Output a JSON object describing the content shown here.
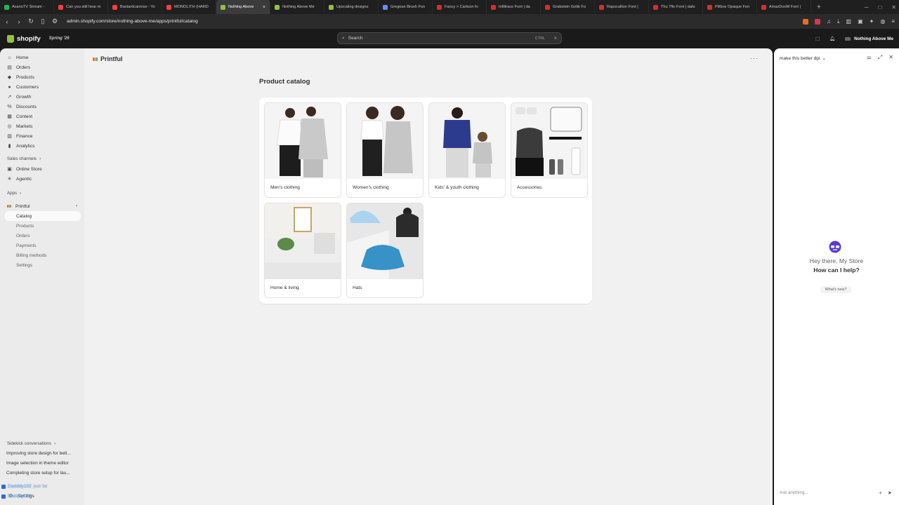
{
  "browser": {
    "tabs": [
      {
        "label": "AsanoTV Stream - ",
        "color": "#1db954"
      },
      {
        "label": "Can you still hear m",
        "color": "#ff3d3d"
      },
      {
        "label": "Bastardcannise - Yo",
        "color": "#ff3d3d"
      },
      {
        "label": "MONOLITH (HARD",
        "color": "#ff3d3d"
      },
      {
        "label": "Nothing Above",
        "color": "#95bf47"
      },
      {
        "label": "Nothing Above Me",
        "color": "#95bf47"
      },
      {
        "label": "Upscaling designs",
        "color": "#95bf47"
      },
      {
        "label": "Gregean Brush Fon",
        "color": "#6b8cff"
      },
      {
        "label": "Fancy > Cartoon fo",
        "color": "#d32f2f"
      },
      {
        "label": "Infiltrace Font | da",
        "color": "#d32f2f"
      },
      {
        "label": "Grabstein Gotik Fo",
        "color": "#d32f2f"
      },
      {
        "label": "Rapscallion Font | ",
        "color": "#d32f2f"
      },
      {
        "label": "Thu Tflo Font | dafu",
        "color": "#d32f2f"
      },
      {
        "label": "Pillbox Opaque Fon",
        "color": "#d32f2f"
      },
      {
        "label": "AmazDooM Font | ",
        "color": "#d32f2f"
      }
    ],
    "active_tab_index": 4,
    "url": "admin.shopify.com/store/nothing-above-me/apps/printful/catalog"
  },
  "topbar": {
    "logo_text": "shopify",
    "season": "Spring '26",
    "search_placeholder": "Search",
    "shortcut_key": "CTRL",
    "shortcut_letter": "K",
    "store_name": "Nothing Above Me"
  },
  "sidebar": {
    "main_nav": [
      {
        "label": "Home",
        "icon": "home-icon"
      },
      {
        "label": "Orders",
        "icon": "inbox-icon"
      },
      {
        "label": "Products",
        "icon": "tag-icon"
      },
      {
        "label": "Customers",
        "icon": "person-icon"
      },
      {
        "label": "Growth",
        "icon": "growth-icon"
      },
      {
        "label": "Discounts",
        "icon": "discount-icon"
      },
      {
        "label": "Content",
        "icon": "content-icon"
      },
      {
        "label": "Markets",
        "icon": "globe-icon"
      },
      {
        "label": "Finance",
        "icon": "bank-icon"
      },
      {
        "label": "Analytics",
        "icon": "chart-icon"
      }
    ],
    "sales_channels_heading": "Sales channels",
    "sales_channels": [
      {
        "label": "Online Store",
        "icon": "store-icon"
      },
      {
        "label": "Agentic",
        "icon": "agentic-icon"
      }
    ],
    "apps_heading": "Apps",
    "app_name": "Printful",
    "app_subitems": [
      "Catalog",
      "Products",
      "Orders",
      "Payments",
      "Billing methods",
      "Settings"
    ],
    "conversations_heading": "Sidekick conversations",
    "conversations": [
      "Improving store design for bett...",
      "Image selection in theme editor",
      "Completing store setup for lau..."
    ],
    "settings_label": "Settings",
    "chat_overlay": [
      {
        "user": "Dadddy102",
        "message": "just fat"
      },
      {
        "user": "Dadddy102",
        "message": ""
      }
    ]
  },
  "main": {
    "app_title": "Printful",
    "page_title": "Product catalog",
    "categories": [
      {
        "label": "Men's clothing"
      },
      {
        "label": "Women's clothing"
      },
      {
        "label": "Kids' & youth clothing"
      },
      {
        "label": "Accessories"
      },
      {
        "label": "Home & living"
      },
      {
        "label": "Hats"
      }
    ]
  },
  "sidekick": {
    "conversation_title": "make this better dpi",
    "greeting": "Hey there, My Store",
    "prompt": "How can I help?",
    "whats_new": "What's new?",
    "input_placeholder": "Ask anything..."
  }
}
